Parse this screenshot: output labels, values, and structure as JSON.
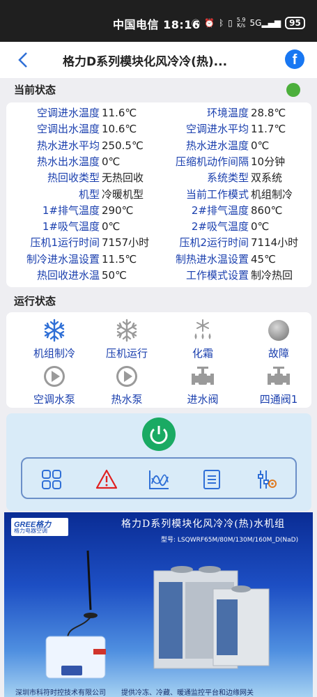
{
  "statusbar": {
    "carrier_time": "中国电信 18:16",
    "net_speed_top": "5.9",
    "net_speed_bottom": "K/s",
    "signal": "5G",
    "battery": "95"
  },
  "header": {
    "title": "格力D系列模块化风冷冷(热)..."
  },
  "current_status": {
    "heading": "当前状态",
    "rows": [
      {
        "l1": "空调进水温度",
        "v1": "11.6℃",
        "l2": "环境温度",
        "v2": "28.8℃"
      },
      {
        "l1": "空调出水温度",
        "v1": "10.6℃",
        "l2": "空调进水平均",
        "v2": "11.7℃"
      },
      {
        "l1": "热水进水平均",
        "v1": "250.5℃",
        "l2": "热水进水温度",
        "v2": "0℃"
      },
      {
        "l1": "热水出水温度",
        "v1": "0℃",
        "l2": "压缩机动作间隔",
        "v2": "10分钟"
      },
      {
        "l1": "热回收类型",
        "v1": "无热回收",
        "l2": "系统类型",
        "v2": "双系统"
      },
      {
        "l1": "机型",
        "v1": "冷暖机型",
        "l2": "当前工作模式",
        "v2": "机组制冷"
      },
      {
        "l1": "1#排气温度",
        "v1": "290℃",
        "l2": "2#排气温度",
        "v2": "860℃"
      },
      {
        "l1": "1#吸气温度",
        "v1": "0℃",
        "l2": "2#吸气温度",
        "v2": "0℃"
      },
      {
        "l1": "压机1运行时间",
        "v1": "7157小时",
        "l2": "压机2运行时间",
        "v2": "7114小时"
      },
      {
        "l1": "制冷进水温设置",
        "v1": "11.5℃",
        "l2": "制热进水温设置",
        "v2": "45℃"
      },
      {
        "l1": "热回收进水温",
        "v1": "50℃",
        "l2": "工作模式设置",
        "v2": "制冷热回"
      }
    ]
  },
  "run_status": {
    "heading": "运行状态",
    "items": [
      {
        "label": "机组制冷",
        "icon": "snowflake-icon",
        "active": true
      },
      {
        "label": "压机运行",
        "icon": "snowflake-icon",
        "active": false
      },
      {
        "label": "化霜",
        "icon": "defrost-icon",
        "active": false
      },
      {
        "label": "故障",
        "icon": "fault-indicator-icon",
        "active": false
      },
      {
        "label": "空调水泵",
        "icon": "pump-icon",
        "active": false
      },
      {
        "label": "热水泵",
        "icon": "pump-icon",
        "active": false
      },
      {
        "label": "进水阀",
        "icon": "valve-icon",
        "active": false
      },
      {
        "label": "四通阀1",
        "icon": "valve-icon",
        "active": false
      }
    ]
  },
  "controls": {
    "power_icon": "power-icon",
    "tools": [
      "grid-menu-icon",
      "warning-icon",
      "trend-chart-icon",
      "list-doc-icon",
      "settings-sliders-icon"
    ]
  },
  "banner": {
    "brand": "GREE格力",
    "brand_sub": "格力电器空调",
    "title": "格力D系列模块化风冷冷(热)水机组",
    "model": "型号: LSQWRF65M/80M/130M/160M_D(NaD)",
    "footer_left": "深圳市科符时控技术有限公司",
    "footer_right": "提供冷冻、冷藏、暖通监控平台和边缘网关"
  },
  "colors": {
    "label_blue": "#1a3fae",
    "accent_blue": "#2f6fd6",
    "status_green": "#4caf3c",
    "power_green": "#1aaa63",
    "fault_gray": "#9a9a9a"
  }
}
